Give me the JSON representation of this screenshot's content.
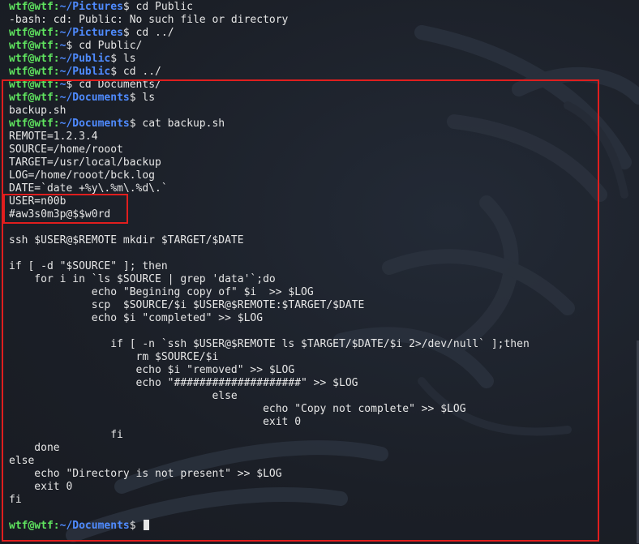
{
  "prompt": {
    "user": "wtf@wtf",
    "sep": ":",
    "dollar": "$"
  },
  "lines": [
    {
      "kind": "prompt",
      "path": "~/Pictures",
      "cmd": " cd Public"
    },
    {
      "kind": "text",
      "text": "-bash: cd: Public: No such file or directory"
    },
    {
      "kind": "prompt",
      "path": "~/Pictures",
      "cmd": " cd ../"
    },
    {
      "kind": "prompt",
      "path": "~",
      "cmd": " cd Public/"
    },
    {
      "kind": "prompt",
      "path": "~/Public",
      "cmd": " ls"
    },
    {
      "kind": "prompt",
      "path": "~/Public",
      "cmd": " cd ../"
    },
    {
      "kind": "prompt",
      "path": "~",
      "cmd": " cd Documents/"
    },
    {
      "kind": "prompt",
      "path": "~/Documents",
      "cmd": " ls"
    },
    {
      "kind": "text",
      "text": "backup.sh"
    },
    {
      "kind": "prompt",
      "path": "~/Documents",
      "cmd": " cat backup.sh"
    },
    {
      "kind": "text",
      "text": "REMOTE=1.2.3.4"
    },
    {
      "kind": "text",
      "text": "SOURCE=/home/rooot"
    },
    {
      "kind": "text",
      "text": "TARGET=/usr/local/backup"
    },
    {
      "kind": "text",
      "text": "LOG=/home/rooot/bck.log"
    },
    {
      "kind": "text",
      "text": "DATE=`date +%y\\.%m\\.%d\\.`"
    },
    {
      "kind": "text",
      "text": "USER=n00b"
    },
    {
      "kind": "text",
      "text": "#aw3s0m3p@$$w0rd"
    },
    {
      "kind": "text",
      "text": ""
    },
    {
      "kind": "text",
      "text": "ssh $USER@$REMOTE mkdir $TARGET/$DATE"
    },
    {
      "kind": "text",
      "text": ""
    },
    {
      "kind": "text",
      "text": "if [ -d \"$SOURCE\" ]; then"
    },
    {
      "kind": "text",
      "text": "    for i in `ls $SOURCE | grep 'data'`;do"
    },
    {
      "kind": "text",
      "text": "             echo \"Begining copy of\" $i  >> $LOG"
    },
    {
      "kind": "text",
      "text": "             scp  $SOURCE/$i $USER@$REMOTE:$TARGET/$DATE"
    },
    {
      "kind": "text",
      "text": "             echo $i \"completed\" >> $LOG"
    },
    {
      "kind": "text",
      "text": ""
    },
    {
      "kind": "text",
      "text": "                if [ -n `ssh $USER@$REMOTE ls $TARGET/$DATE/$i 2>/dev/null` ];then"
    },
    {
      "kind": "text",
      "text": "                    rm $SOURCE/$i"
    },
    {
      "kind": "text",
      "text": "                    echo $i \"removed\" >> $LOG"
    },
    {
      "kind": "text",
      "text": "                    echo \"####################\" >> $LOG"
    },
    {
      "kind": "text",
      "text": "                                else"
    },
    {
      "kind": "text",
      "text": "                                        echo \"Copy not complete\" >> $LOG"
    },
    {
      "kind": "text",
      "text": "                                        exit 0"
    },
    {
      "kind": "text",
      "text": "                fi"
    },
    {
      "kind": "text",
      "text": "    done"
    },
    {
      "kind": "text",
      "text": "else"
    },
    {
      "kind": "text",
      "text": "    echo \"Directory is not present\" >> $LOG"
    },
    {
      "kind": "text",
      "text": "    exit 0"
    },
    {
      "kind": "text",
      "text": "fi"
    },
    {
      "kind": "text",
      "text": ""
    },
    {
      "kind": "prompt",
      "path": "~/Documents",
      "cmd": " ",
      "cursor": true
    }
  ],
  "colors": {
    "user": "#5fe35f",
    "path": "#4f8bff",
    "text": "#e6e6e6",
    "highlight": "#e01e1e",
    "background": "#1c2028"
  }
}
